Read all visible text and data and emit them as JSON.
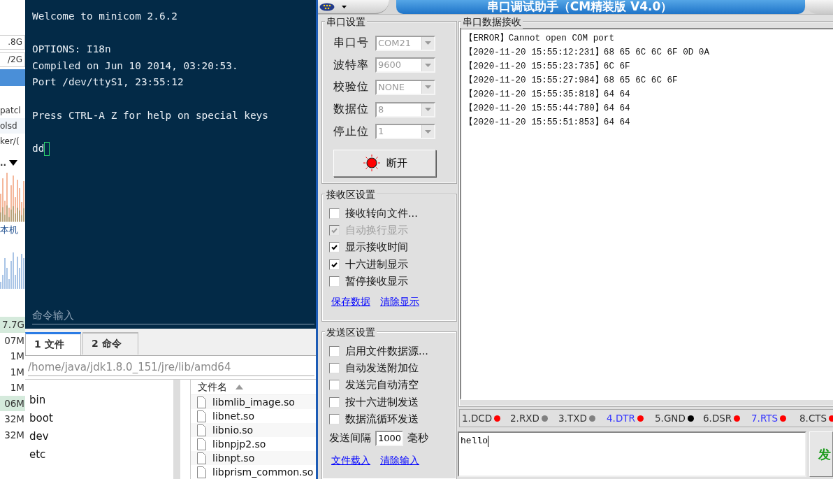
{
  "side_strip": {
    "fields": [
      ".8G",
      "/2G"
    ],
    "rows": [
      "patcl",
      "olsd",
      "ker/("
    ],
    "menu": "..",
    "label": "本机",
    "sizes": [
      {
        "text": "7.7G",
        "highlighted": true
      },
      {
        "text": "07M",
        "highlighted": false
      },
      {
        "text": "1M",
        "highlighted": false
      },
      {
        "text": "1M",
        "highlighted": false
      },
      {
        "text": "1M",
        "highlighted": false
      },
      {
        "text": "06M",
        "highlighted": true
      },
      {
        "text": "32M",
        "highlighted": false
      },
      {
        "text": "32M",
        "highlighted": false
      }
    ]
  },
  "terminal": {
    "blocks": [
      [
        "Welcome to minicom 2.6.2"
      ],
      [
        "OPTIONS: I18n",
        "Compiled on Jun 10 2014, 03:20:53.",
        "Port /dev/ttyS1, 23:55:12"
      ],
      [
        "Press CTRL-A Z for help on special keys"
      ],
      [
        "dd"
      ]
    ],
    "command_input": {
      "placeholder": "命令输入"
    }
  },
  "file_panel": {
    "tabs": [
      {
        "label": "1 文件",
        "selected": true
      },
      {
        "label": "2 命令",
        "selected": false
      }
    ],
    "path": "/home/java/jdk1.8.0_151/jre/lib/amd64",
    "tree": [
      "bin",
      "boot",
      "dev",
      "etc"
    ],
    "list_header": "文件名",
    "files": [
      "libmlib_image.so",
      "libnet.so",
      "libnio.so",
      "libnpjp2.so",
      "libnpt.so",
      "libprism_common.so"
    ]
  },
  "serial_tool": {
    "title": "串口调试助手（CM精装版 V4.0）",
    "port_settings": {
      "title": "串口设置",
      "fields": [
        {
          "label": "串口号",
          "value": "COM21"
        },
        {
          "label": "波特率",
          "value": "9600"
        },
        {
          "label": "校验位",
          "value": "NONE"
        },
        {
          "label": "数据位",
          "value": "8"
        },
        {
          "label": "停止位",
          "value": "1"
        }
      ],
      "button": "断开"
    },
    "receive_settings": {
      "title": "接收区设置",
      "options": [
        {
          "label": "接收转向文件...",
          "checked": false,
          "disabled": false
        },
        {
          "label": "自动换行显示",
          "checked": true,
          "disabled": true
        },
        {
          "label": "显示接收时间",
          "checked": true,
          "disabled": false
        },
        {
          "label": "十六进制显示",
          "checked": true,
          "disabled": false
        },
        {
          "label": "暂停接收显示",
          "checked": false,
          "disabled": false
        }
      ],
      "links": [
        "保存数据",
        "清除显示"
      ]
    },
    "send_settings": {
      "title": "发送区设置",
      "options": [
        {
          "label": "启用文件数据源...",
          "checked": false,
          "disabled": false
        },
        {
          "label": "自动发送附加位",
          "checked": false,
          "disabled": false
        },
        {
          "label": "发送完自动清空",
          "checked": false,
          "disabled": false
        },
        {
          "label": "按十六进制发送",
          "checked": false,
          "disabled": false
        },
        {
          "label": "数据流循环发送",
          "checked": false,
          "disabled": false
        }
      ],
      "interval": {
        "label": "发送间隔",
        "value": "1000",
        "unit": "毫秒"
      },
      "links": [
        "文件载入",
        "清除输入"
      ]
    },
    "receive": {
      "title": "串口数据接收",
      "lines": [
        "【ERROR】Cannot open COM port",
        "【2020-11-20 15:55:12:231】68 65 6C 6C 6F 0D 0A",
        "【2020-11-20 15:55:23:735】6C 6F",
        "【2020-11-20 15:55:27:984】68 65 6C 6C 6F",
        "【2020-11-20 15:55:35:818】64 64",
        "【2020-11-20 15:55:44:780】64 64",
        "【2020-11-20 15:55:51:853】64 64"
      ]
    },
    "pins": [
      {
        "label": "1.DCD",
        "color": "#ff0000",
        "highlighted": false
      },
      {
        "label": "2.RXD",
        "color": "#808080",
        "highlighted": false
      },
      {
        "label": "3.TXD",
        "color": "#808080",
        "highlighted": false
      },
      {
        "label": "4.DTR",
        "color": "#ff0000",
        "highlighted": true
      },
      {
        "label": "5.GND",
        "color": "#000000",
        "highlighted": false
      },
      {
        "label": "6.DSR",
        "color": "#ff0000",
        "highlighted": false
      },
      {
        "label": "7.RTS",
        "color": "#ff0000",
        "highlighted": true
      },
      {
        "label": "8.CTS",
        "color": "#ff0000",
        "highlighted": false
      }
    ],
    "send_input": {
      "value": "hello"
    },
    "send_button": "发"
  }
}
